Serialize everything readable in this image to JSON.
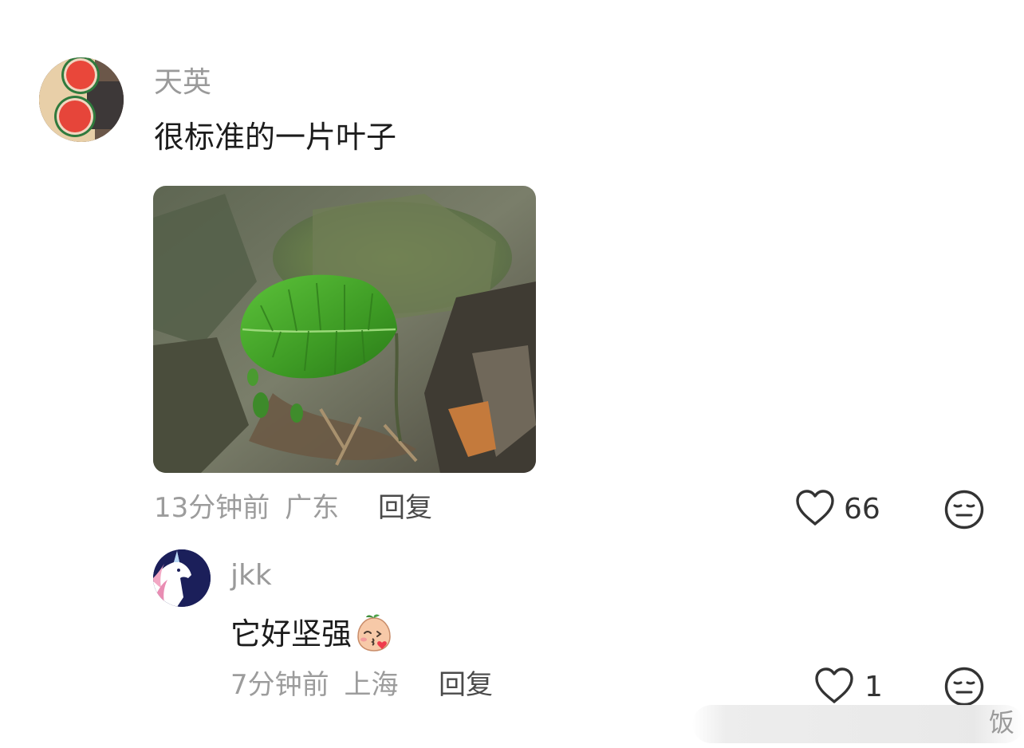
{
  "comment": {
    "author": "天英",
    "text": "很标准的一片叶子",
    "time": "13分钟前",
    "location": "广东",
    "reply_label": "回复",
    "likes": "66"
  },
  "reply": {
    "author": "jkk",
    "text": "它好坚强",
    "time": "7分钟前",
    "location": "上海",
    "reply_label": "回复",
    "likes": "1"
  },
  "watermark": {
    "text": "饭"
  },
  "icons": {
    "like": "heart-outline-icon",
    "dislike": "meh-face-icon",
    "emoji": "blushing-peach-emoji-icon"
  },
  "colors": {
    "username": "#9a9a9a",
    "meta": "#9c9c9c",
    "text": "#1c1c1c"
  }
}
